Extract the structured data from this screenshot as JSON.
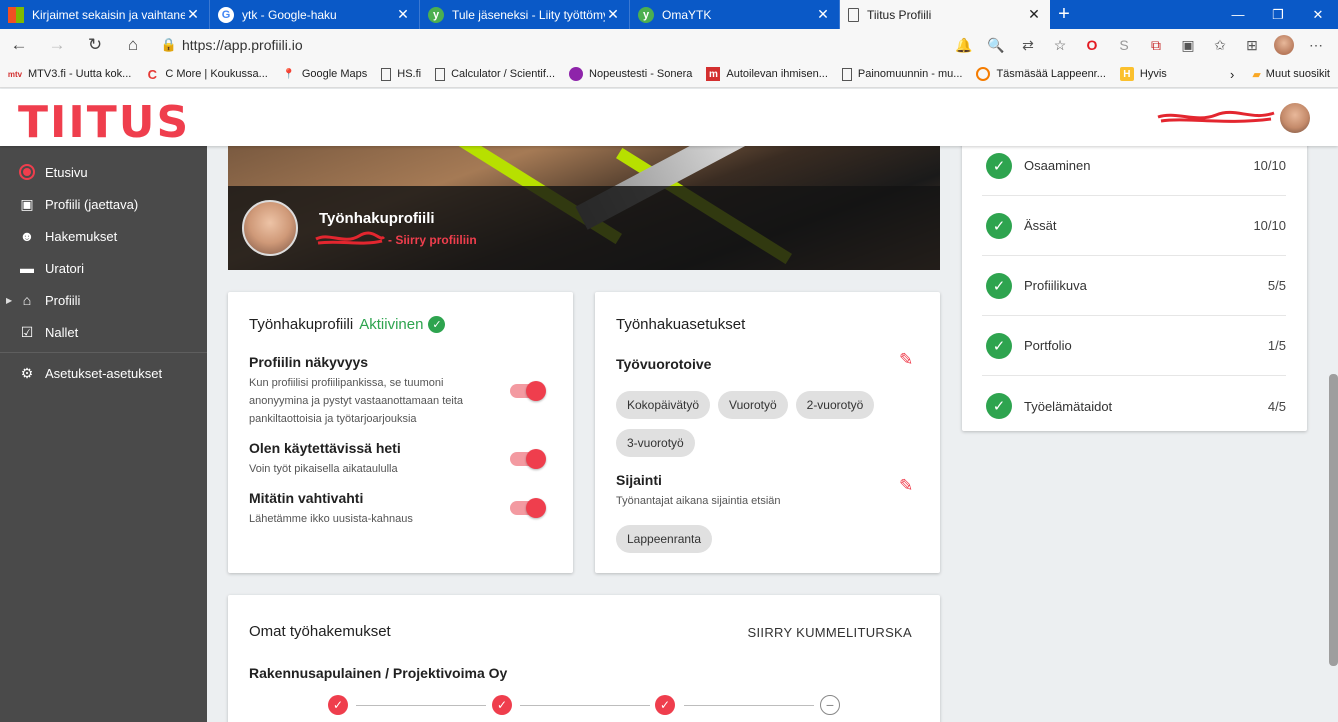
{
  "browser": {
    "tabs": [
      {
        "title": "Kirjaimet sekaisin ja vaihtaneet p",
        "icon": "microsoft-icon",
        "active": false
      },
      {
        "title": "ytk - Google-haku",
        "icon": "google-icon",
        "active": false
      },
      {
        "title": "Tule jäseneksi - Liity työttömyysl",
        "icon": "ytk-icon",
        "active": false
      },
      {
        "title": "OmaYTK",
        "icon": "ytk-icon",
        "active": false
      },
      {
        "title": "Tiitus Profiili",
        "icon": "page-icon",
        "active": true
      }
    ],
    "url": "https://app.profiili.io",
    "bookmarks": [
      {
        "label": "MTV3.fi - Uutta kok...",
        "icon": "mtv-icon"
      },
      {
        "label": "C More | Koukussa...",
        "icon": "cmore-icon"
      },
      {
        "label": "Google Maps",
        "icon": "maps-icon"
      },
      {
        "label": "HS.fi",
        "icon": "page-icon"
      },
      {
        "label": "Calculator / Scientif...",
        "icon": "page-icon"
      },
      {
        "label": "Nopeustesti - Sonera",
        "icon": "sonera-icon"
      },
      {
        "label": "Autoilevan ihmisen...",
        "icon": "m-icon"
      },
      {
        "label": "Painomuunnin - mu...",
        "icon": "page-icon"
      },
      {
        "label": "Täsmäsää Lappeenr...",
        "icon": "weather-icon"
      },
      {
        "label": "Hyvis",
        "icon": "hyvis-icon"
      }
    ],
    "other_bookmarks": "Muut suosikit"
  },
  "app": {
    "logo": "TIITUS"
  },
  "sidebar": {
    "items": [
      {
        "label": "Etusivu",
        "icon": "home-circle-icon"
      },
      {
        "label": "Profiili (jaettava)",
        "icon": "profile-badge-icon"
      },
      {
        "label": "Hakemukset",
        "icon": "face-icon"
      },
      {
        "label": "Uratori",
        "icon": "briefcase-icon"
      },
      {
        "label": "Profiili",
        "icon": "house-icon"
      },
      {
        "label": "Nallet",
        "icon": "checkbox-icon"
      },
      {
        "label": "Asetukset-asetukset",
        "icon": "gear-icon"
      }
    ]
  },
  "cover": {
    "title": "Työnhakuprofiili",
    "link": "Siirry profiiliin"
  },
  "profile_card": {
    "title": "Työnhakuprofiili",
    "status": "Aktiivinen",
    "settings": [
      {
        "label": "Profiilin näkyvyys",
        "desc": "Kun profiilisi profiilipankissa, se tuumoni anonyymina ja pystyt vastaanottamaan teita pankiltaottoisia ja työtarjoarjouksia",
        "on": true
      },
      {
        "label": "Olen käytettävissä heti",
        "desc": "Voin työt pikaisella aikataululla",
        "on": true
      },
      {
        "label": "Mitätin vahtivahti",
        "desc": "Lähetämme ikko uusista-kahnaus",
        "on": true
      }
    ]
  },
  "job_settings": {
    "title": "Työnhakuasetukset",
    "shift_label": "Työvuorotoive",
    "shifts": [
      "Kokopäivätyö",
      "Vuorotyö",
      "2-vuorotyö",
      "3-vuorotyö"
    ],
    "location_label": "Sijainti",
    "location_desc": "Työnantajat aikana sijaintia etsiän",
    "locations": [
      "Lappeenranta"
    ]
  },
  "scores": [
    {
      "name": "Osaaminen",
      "score": "10/10"
    },
    {
      "name": "Ässät",
      "score": "10/10"
    },
    {
      "name": "Profiilikuva",
      "score": "5/5"
    },
    {
      "name": "Portfolio",
      "score": "1/5"
    },
    {
      "name": "Työelämätaidot",
      "score": "4/5"
    }
  ],
  "applications": {
    "title": "Omat työhakemukset",
    "action": "SIIRRY KUMMELITURSKA",
    "first_job": "Rakennusapulainen / Projektivoima Oy",
    "steps_done": 3,
    "steps_total": 4
  },
  "colors": {
    "brand": "#ef3e4d",
    "success": "#2ea44f",
    "sidebar": "#4a4a4a",
    "tabbar": "#0a59c7"
  }
}
